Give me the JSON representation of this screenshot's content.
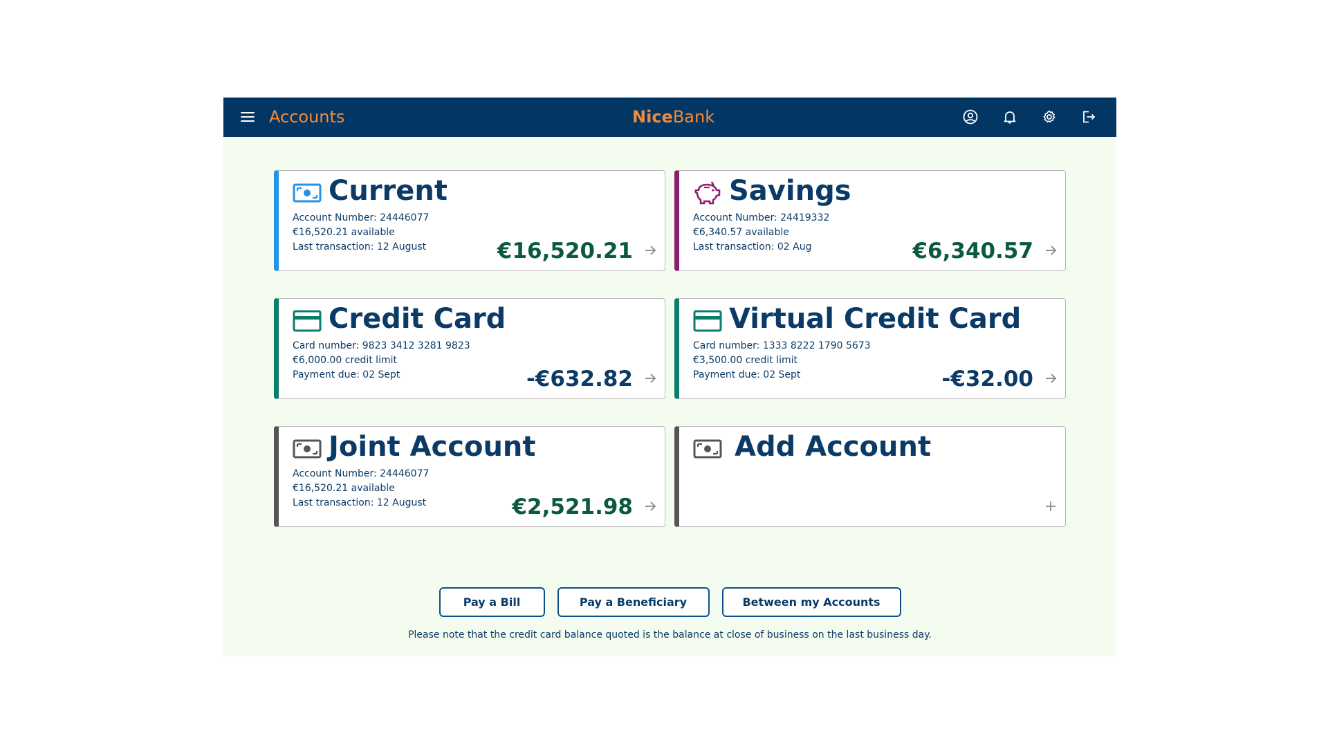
{
  "header": {
    "title": "Accounts",
    "brand_bold": "Nice",
    "brand_regular": "Bank",
    "icons": [
      "menu-icon",
      "user-icon",
      "bell-icon",
      "gear-icon",
      "logout-icon"
    ]
  },
  "colors": {
    "topbar": "#023664",
    "accent": "#f28a3a",
    "current": "#2493e6",
    "savings": "#8c1f6b",
    "credit": "#0a7d6b",
    "joint": "#555555",
    "positive_amount": "#0a5a3c",
    "negative_amount": "#0b3a66"
  },
  "accounts": [
    {
      "icon": "banknote-icon",
      "title": "Current",
      "line1": "Account Number: 24446077",
      "line2": "€16,520.21 available",
      "line3": "Last transaction: 12 August",
      "amount": "€16,520.21"
    },
    {
      "icon": "piggy-bank-icon",
      "title": "Savings",
      "line1": "Account Number: 24419332",
      "line2": "€6,340.57 available",
      "line3": "Last transaction: 02 Aug",
      "amount": "€6,340.57"
    },
    {
      "icon": "credit-card-icon",
      "title": "Credit Card",
      "line1": "Card number: 9823 3412 3281 9823",
      "line2": "€6,000.00 credit limit",
      "line3": "Payment due: 02 Sept",
      "amount": "-€632.82"
    },
    {
      "icon": "credit-card-icon",
      "title": "Virtual Credit Card",
      "line1": "Card number: 1333 8222 1790 5673",
      "line2": "€3,500.00 credit limit",
      "line3": "Payment due: 02 Sept",
      "amount": "-€32.00"
    },
    {
      "icon": "banknote-icon",
      "title": "Joint Account",
      "line1": "Account Number: 24446077",
      "line2": "€16,520.21 available",
      "line3": "Last transaction: 12 August",
      "amount": "€2,521.98"
    },
    {
      "icon": "banknote-icon",
      "title": "Add Account",
      "line1": "",
      "line2": "",
      "line3": "",
      "amount": ""
    }
  ],
  "actions": {
    "pay_bill": "Pay a Bill",
    "pay_beneficiary": "Pay a Beneficiary",
    "between_accounts": "Between my Accounts"
  },
  "note": "Please note that the credit card balance quoted is the balance at close of business on the last business day."
}
